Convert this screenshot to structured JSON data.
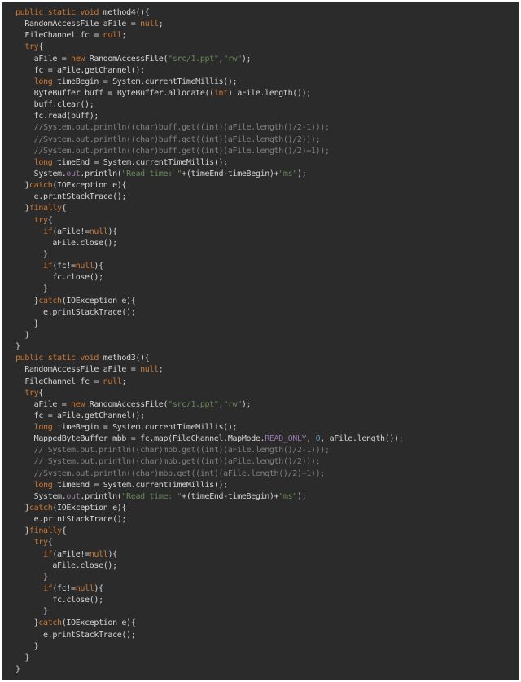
{
  "editor": {
    "background": "#2b2b2b",
    "colors": {
      "keyword": "#cc7832",
      "string": "#6a8759",
      "comment": "#808080",
      "number": "#6897bb",
      "field": "#9876aa",
      "plain": "#d4d4d4"
    },
    "lines": [
      [
        [
          "kw",
          "public static void "
        ],
        [
          "plain",
          "method4(){"
        ]
      ],
      [
        [
          "plain",
          "  RandomAccessFile aFile = "
        ],
        [
          "kw",
          "null"
        ],
        [
          "plain",
          ";"
        ]
      ],
      [
        [
          "plain",
          "  FileChannel fc = "
        ],
        [
          "kw",
          "null"
        ],
        [
          "plain",
          ";"
        ]
      ],
      [
        [
          "plain",
          "  "
        ],
        [
          "kw",
          "try"
        ],
        [
          "plain",
          "{"
        ]
      ],
      [
        [
          "plain",
          "    aFile = "
        ],
        [
          "kw",
          "new "
        ],
        [
          "plain",
          "RandomAccessFile("
        ],
        [
          "str",
          "\"src/1.ppt\""
        ],
        [
          "plain",
          ","
        ],
        [
          "str",
          "\"rw\""
        ],
        [
          "plain",
          ");"
        ]
      ],
      [
        [
          "plain",
          "    fc = aFile.getChannel();"
        ]
      ],
      [
        [
          "plain",
          "    "
        ],
        [
          "kw",
          "long "
        ],
        [
          "plain",
          "timeBegin = System.currentTimeMillis();"
        ]
      ],
      [
        [
          "plain",
          "    ByteBuffer buff = ByteBuffer.allocate(("
        ],
        [
          "kw",
          "int"
        ],
        [
          "plain",
          ") aFile.length());"
        ]
      ],
      [
        [
          "plain",
          "    buff.clear();"
        ]
      ],
      [
        [
          "plain",
          "    fc.read(buff);"
        ]
      ],
      [
        [
          "cmt",
          "    //System.out.println((char)buff.get((int)(aFile.length()/2-1)));"
        ]
      ],
      [
        [
          "cmt",
          "    //System.out.println((char)buff.get((int)(aFile.length()/2)));"
        ]
      ],
      [
        [
          "cmt",
          "    //System.out.println((char)buff.get((int)(aFile.length()/2)+1));"
        ]
      ],
      [
        [
          "plain",
          "    "
        ],
        [
          "kw",
          "long "
        ],
        [
          "plain",
          "timeEnd = System.currentTimeMillis();"
        ]
      ],
      [
        [
          "plain",
          "    System."
        ],
        [
          "fld",
          "out"
        ],
        [
          "plain",
          ".println("
        ],
        [
          "str",
          "\"Read time: \""
        ],
        [
          "plain",
          "+(timeEnd-timeBegin)+"
        ],
        [
          "str",
          "\"ms\""
        ],
        [
          "plain",
          ");"
        ]
      ],
      [
        [
          "plain",
          "  }"
        ],
        [
          "kw",
          "catch"
        ],
        [
          "plain",
          "(IOException e){"
        ]
      ],
      [
        [
          "plain",
          "    e.printStackTrace();"
        ]
      ],
      [
        [
          "plain",
          "  }"
        ],
        [
          "kw",
          "finally"
        ],
        [
          "plain",
          "{"
        ]
      ],
      [
        [
          "plain",
          "    "
        ],
        [
          "kw",
          "try"
        ],
        [
          "plain",
          "{"
        ]
      ],
      [
        [
          "plain",
          "      "
        ],
        [
          "kw",
          "if"
        ],
        [
          "plain",
          "(aFile!="
        ],
        [
          "kw",
          "null"
        ],
        [
          "plain",
          "){"
        ]
      ],
      [
        [
          "plain",
          "        aFile.close();"
        ]
      ],
      [
        [
          "plain",
          "      }"
        ]
      ],
      [
        [
          "plain",
          "      "
        ],
        [
          "kw",
          "if"
        ],
        [
          "plain",
          "(fc!="
        ],
        [
          "kw",
          "null"
        ],
        [
          "plain",
          "){"
        ]
      ],
      [
        [
          "plain",
          "        fc.close();"
        ]
      ],
      [
        [
          "plain",
          "      }"
        ]
      ],
      [
        [
          "plain",
          "    }"
        ],
        [
          "kw",
          "catch"
        ],
        [
          "plain",
          "(IOException e){"
        ]
      ],
      [
        [
          "plain",
          "      e.printStackTrace();"
        ]
      ],
      [
        [
          "plain",
          "    }"
        ]
      ],
      [
        [
          "plain",
          "  }"
        ]
      ],
      [
        [
          "plain",
          "}"
        ]
      ],
      [
        [
          "kw",
          "public static void "
        ],
        [
          "plain",
          "method3(){"
        ]
      ],
      [
        [
          "plain",
          "  RandomAccessFile aFile = "
        ],
        [
          "kw",
          "null"
        ],
        [
          "plain",
          ";"
        ]
      ],
      [
        [
          "plain",
          "  FileChannel fc = "
        ],
        [
          "kw",
          "null"
        ],
        [
          "plain",
          ";"
        ]
      ],
      [
        [
          "plain",
          "  "
        ],
        [
          "kw",
          "try"
        ],
        [
          "plain",
          "{"
        ]
      ],
      [
        [
          "plain",
          "    aFile = "
        ],
        [
          "kw",
          "new "
        ],
        [
          "plain",
          "RandomAccessFile("
        ],
        [
          "str",
          "\"src/1.ppt\""
        ],
        [
          "plain",
          ","
        ],
        [
          "str",
          "\"rw\""
        ],
        [
          "plain",
          ");"
        ]
      ],
      [
        [
          "plain",
          "    fc = aFile.getChannel();"
        ]
      ],
      [
        [
          "plain",
          "    "
        ],
        [
          "kw",
          "long "
        ],
        [
          "plain",
          "timeBegin = System.currentTimeMillis();"
        ]
      ],
      [
        [
          "plain",
          "    MappedByteBuffer mbb = fc.map(FileChannel.MapMode."
        ],
        [
          "fld",
          "READ_ONLY"
        ],
        [
          "plain",
          ", "
        ],
        [
          "num",
          "0"
        ],
        [
          "plain",
          ", aFile.length());"
        ]
      ],
      [
        [
          "cmt",
          "    // System.out.println((char)mbb.get((int)(aFile.length()/2-1)));"
        ]
      ],
      [
        [
          "cmt",
          "    // System.out.println((char)mbb.get((int)(aFile.length()/2)));"
        ]
      ],
      [
        [
          "cmt",
          "    //System.out.println((char)mbb.get((int)(aFile.length()/2)+1));"
        ]
      ],
      [
        [
          "plain",
          "    "
        ],
        [
          "kw",
          "long "
        ],
        [
          "plain",
          "timeEnd = System.currentTimeMillis();"
        ]
      ],
      [
        [
          "plain",
          "    System."
        ],
        [
          "fld",
          "out"
        ],
        [
          "plain",
          ".println("
        ],
        [
          "str",
          "\"Read time: \""
        ],
        [
          "plain",
          "+(timeEnd-timeBegin)+"
        ],
        [
          "str",
          "\"ms\""
        ],
        [
          "plain",
          ");"
        ]
      ],
      [
        [
          "plain",
          "  }"
        ],
        [
          "kw",
          "catch"
        ],
        [
          "plain",
          "(IOException e){"
        ]
      ],
      [
        [
          "plain",
          "    e.printStackTrace();"
        ]
      ],
      [
        [
          "plain",
          "  }"
        ],
        [
          "kw",
          "finally"
        ],
        [
          "plain",
          "{"
        ]
      ],
      [
        [
          "plain",
          "    "
        ],
        [
          "kw",
          "try"
        ],
        [
          "plain",
          "{"
        ]
      ],
      [
        [
          "plain",
          "      "
        ],
        [
          "kw",
          "if"
        ],
        [
          "plain",
          "(aFile!="
        ],
        [
          "kw",
          "null"
        ],
        [
          "plain",
          "){"
        ]
      ],
      [
        [
          "plain",
          "        aFile.close();"
        ]
      ],
      [
        [
          "plain",
          "      }"
        ]
      ],
      [
        [
          "plain",
          "      "
        ],
        [
          "kw",
          "if"
        ],
        [
          "plain",
          "(fc!="
        ],
        [
          "kw",
          "null"
        ],
        [
          "plain",
          "){"
        ]
      ],
      [
        [
          "plain",
          "        fc.close();"
        ]
      ],
      [
        [
          "plain",
          "      }"
        ]
      ],
      [
        [
          "plain",
          "    }"
        ],
        [
          "kw",
          "catch"
        ],
        [
          "plain",
          "(IOException e){"
        ]
      ],
      [
        [
          "plain",
          "      e.printStackTrace();"
        ]
      ],
      [
        [
          "plain",
          "    }"
        ]
      ],
      [
        [
          "plain",
          "  }"
        ]
      ],
      [
        [
          "plain",
          "}"
        ]
      ]
    ]
  }
}
